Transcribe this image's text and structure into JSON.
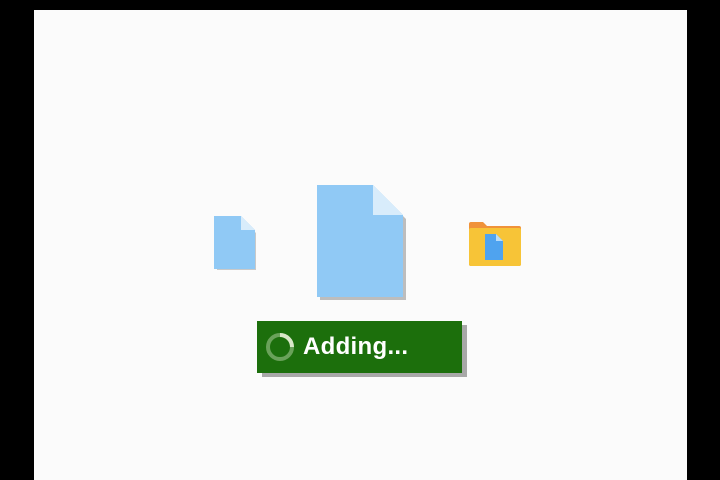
{
  "status_toast": {
    "label": "Adding...",
    "background_color": "#1c6f0c"
  },
  "icons": {
    "small_file": "document-icon",
    "large_file": "document-icon",
    "folder": "folder-with-document-icon",
    "spinner": "loading-spinner-icon"
  },
  "colors": {
    "file_fill": "#90c9f5",
    "file_fold": "#d8ecfb",
    "folder_fill": "#f7c437",
    "folder_tab": "#f0923a",
    "canvas": "#fbfbfb"
  }
}
